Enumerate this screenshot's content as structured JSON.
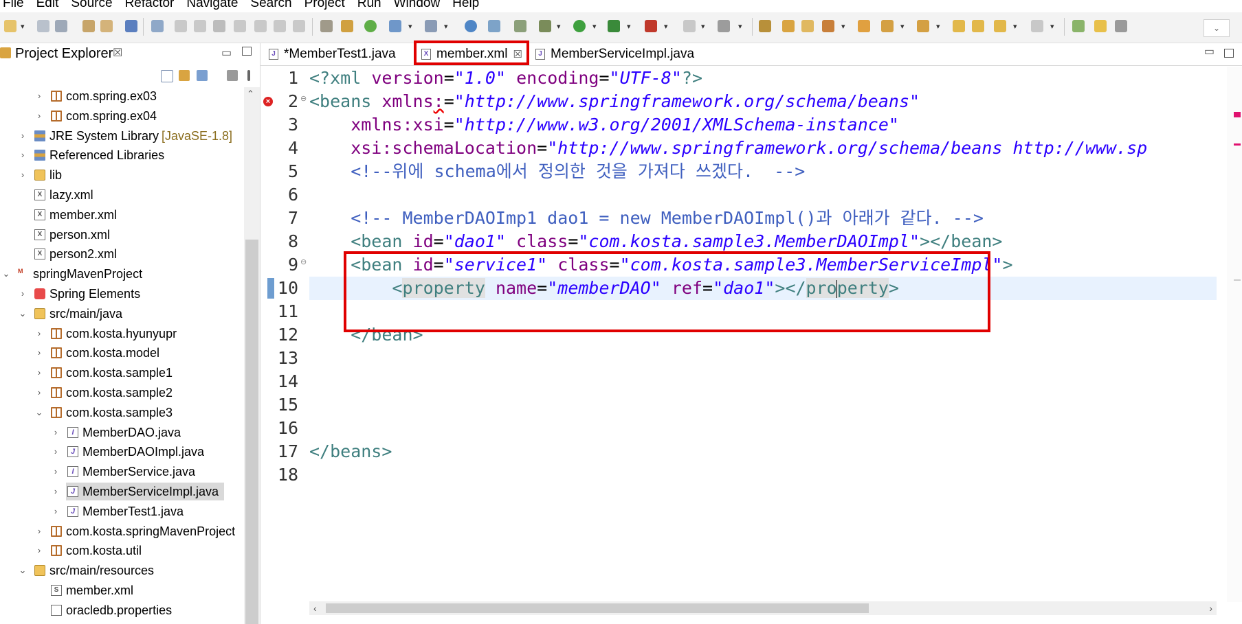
{
  "menu": [
    "File",
    "Edit",
    "Source",
    "Refactor",
    "Navigate",
    "Search",
    "Project",
    "Run",
    "Window",
    "Help"
  ],
  "explorer": {
    "title": "Project Explorer",
    "close_glyph": "☒",
    "tree": [
      {
        "label": "com.spring.ex03",
        "icon": "package-icon",
        "arrow": "›",
        "depth": 2
      },
      {
        "label": "com.spring.ex04",
        "icon": "package-icon",
        "arrow": "›",
        "depth": 2
      },
      {
        "label": "JRE System Library",
        "decoration": "[JavaSE-1.8]",
        "icon": "library-icon",
        "arrow": "›",
        "depth": 1
      },
      {
        "label": "Referenced Libraries",
        "icon": "library-icon",
        "arrow": "›",
        "depth": 1
      },
      {
        "label": "lib",
        "icon": "folder-icon",
        "arrow": "›",
        "depth": 1
      },
      {
        "label": "lazy.xml",
        "icon": "xml-file-icon",
        "arrow": "",
        "depth": 1
      },
      {
        "label": "member.xml",
        "icon": "xml-file-icon",
        "arrow": "",
        "depth": 1
      },
      {
        "label": "person.xml",
        "icon": "xml-file-icon",
        "arrow": "",
        "depth": 1
      },
      {
        "label": "person2.xml",
        "icon": "xml-file-icon",
        "arrow": "",
        "depth": 1
      },
      {
        "label": "springMavenProject",
        "icon": "maven-project-icon",
        "arrow": "⌄",
        "depth": 0
      },
      {
        "label": "Spring Elements",
        "icon": "spring-icon",
        "arrow": "›",
        "depth": 1
      },
      {
        "label": "src/main/java",
        "icon": "source-folder-icon",
        "arrow": "⌄",
        "depth": 1
      },
      {
        "label": "com.kosta.hyunyupr",
        "icon": "package-icon",
        "arrow": "›",
        "depth": 2
      },
      {
        "label": "com.kosta.model",
        "icon": "package-icon",
        "arrow": "›",
        "depth": 2
      },
      {
        "label": "com.kosta.sample1",
        "icon": "package-icon",
        "arrow": "›",
        "depth": 2
      },
      {
        "label": "com.kosta.sample2",
        "icon": "package-icon",
        "arrow": "›",
        "depth": 2
      },
      {
        "label": "com.kosta.sample3",
        "icon": "package-icon",
        "arrow": "⌄",
        "depth": 2
      },
      {
        "label": "MemberDAO.java",
        "icon": "java-interface-icon",
        "arrow": "›",
        "depth": 3
      },
      {
        "label": "MemberDAOImpl.java",
        "icon": "java-file-icon",
        "arrow": "›",
        "depth": 3
      },
      {
        "label": "MemberService.java",
        "icon": "java-interface-icon",
        "arrow": "›",
        "depth": 3
      },
      {
        "label": "MemberServiceImpl.java",
        "icon": "java-file-icon",
        "arrow": "›",
        "depth": 3,
        "selected": true
      },
      {
        "label": "MemberTest1.java",
        "icon": "java-file-icon",
        "arrow": "›",
        "depth": 3
      },
      {
        "label": "com.kosta.springMavenProject",
        "icon": "package-icon",
        "arrow": "›",
        "depth": 2
      },
      {
        "label": "com.kosta.util",
        "icon": "package-icon",
        "arrow": "›",
        "depth": 2
      },
      {
        "label": "src/main/resources",
        "icon": "source-folder-icon",
        "arrow": "⌄",
        "depth": 1
      },
      {
        "label": "member.xml",
        "icon": "spring-xml-icon",
        "arrow": "",
        "depth": 2
      },
      {
        "label": "oracledb.properties",
        "icon": "properties-file-icon",
        "arrow": "",
        "depth": 2
      }
    ]
  },
  "editor": {
    "tabs": [
      {
        "label": "*MemberTest1.java",
        "icon": "J",
        "closable": false
      },
      {
        "label": "member.xml",
        "icon": "X",
        "closable": true,
        "active": true
      },
      {
        "label": "MemberServiceImpl.java",
        "icon": "J",
        "closable": false
      }
    ],
    "tab_close_glyph": "☒",
    "line_numbers": [
      "1",
      "2",
      "3",
      "4",
      "5",
      "6",
      "7",
      "8",
      "9",
      "10",
      "11",
      "12",
      "13",
      "14",
      "15",
      "16",
      "17",
      "18"
    ],
    "code": {
      "l1": {
        "a": "<?",
        "b": "xml",
        "c": " version",
        "d": "=",
        "e": "\"1.0\"",
        "f": " encoding",
        "g": "=",
        "h": "\"UTF-8\"",
        "i": "?>"
      },
      "l2": {
        "a": "<beans",
        "b": " xmlns",
        "c": ":",
        "d": "=",
        "e": "\"http://www.springframework.org/schema/beans\""
      },
      "l3": {
        "a": "    xmlns:xsi",
        "b": "=",
        "c": "\"http://www.w3.org/2001/XMLSchema-instance\""
      },
      "l4": {
        "a": "    xsi:schemaLocation",
        "b": "=",
        "c": "\"http://www.springframework.org/schema/beans http://www.sp"
      },
      "l5": {
        "a": "    <!--위에 schema에서 정의한 것을 가져다 쓰겠다.  -->"
      },
      "l7": {
        "a": "    <!-- MemberDAOImp1 dao1 = new MemberDAOImpl()과 아래가 같다. -->"
      },
      "l8": {
        "a": "    <bean",
        "b": " id",
        "c": "=",
        "d": "\"dao1\"",
        "e": " class",
        "f": "=",
        "g": "\"com.kosta.sample3.MemberDAOImpl\"",
        "h": "></bean>"
      },
      "l9": {
        "a": "    <bean",
        "b": " id",
        "c": "=",
        "d": "\"service1\"",
        "e": " class",
        "f": "=",
        "g": "\"com.kosta.sample3.MemberServiceImpl\"",
        "h": ">"
      },
      "l10": {
        "a": "        <",
        "b": "property",
        "c": " name",
        "d": "=",
        "e": "\"memberDAO\"",
        "f": " ref",
        "g": "=",
        "h": "\"dao1\"",
        "i": "></",
        "j": "pro",
        "k": "perty",
        "l": ">"
      },
      "l12": {
        "a": "    </bean>"
      },
      "l17": {
        "a": "</beans>"
      }
    }
  },
  "colors": {
    "highlight_box": "#e00000",
    "tag": "#3f7f7f",
    "attribute": "#7f007f",
    "value": "#2a00ff",
    "comment": "#3f5fbf",
    "current_line": "#e8f2fe"
  }
}
